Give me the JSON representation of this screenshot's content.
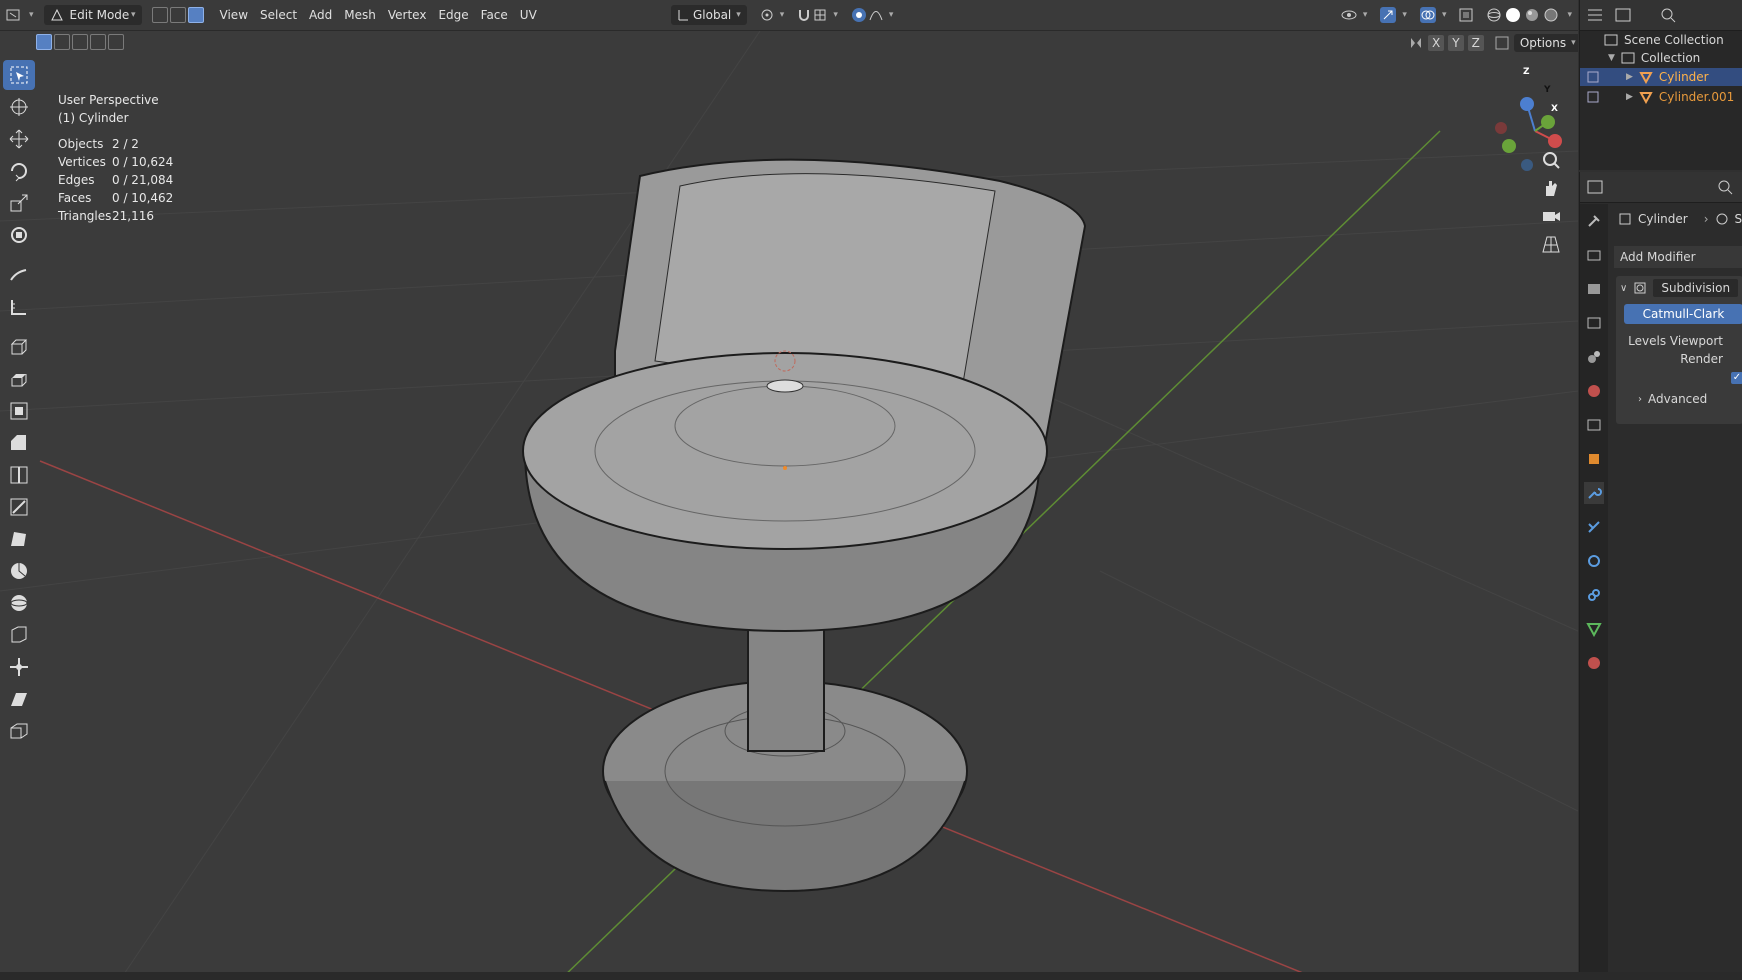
{
  "header": {
    "mode_label": "Edit Mode",
    "menus": [
      "View",
      "Select",
      "Add",
      "Mesh",
      "Vertex",
      "Edge",
      "Face",
      "UV"
    ],
    "orientation_label": "Global",
    "options_label": "Options",
    "axes": [
      "X",
      "Y",
      "Z"
    ]
  },
  "viewport": {
    "view_name": "User Perspective",
    "object_name": "(1) Cylinder",
    "stats": [
      {
        "label": "Objects",
        "value": "2 / 2"
      },
      {
        "label": "Vertices",
        "value": "0 / 10,624"
      },
      {
        "label": "Edges",
        "value": "0 / 21,084"
      },
      {
        "label": "Faces",
        "value": "0 / 10,462"
      },
      {
        "label": "Triangles",
        "value": "21,116"
      }
    ],
    "gizmo": {
      "x": "X",
      "y": "Y",
      "z": "Z"
    },
    "colors": {
      "x_axis": "#b34a4a",
      "y_axis": "#6aa33a",
      "accent": "#4772b3"
    }
  },
  "outliner": {
    "scene_collection": "Scene Collection",
    "collection": "Collection",
    "items": [
      {
        "name": "Cylinder"
      },
      {
        "name": "Cylinder.001"
      }
    ]
  },
  "properties": {
    "breadcrumb_object": "Cylinder",
    "breadcrumb_next": "S",
    "add_modifier": "Add Modifier",
    "modifier_name": "Subdivision",
    "mode_button": "Catmull-Clark",
    "levels_viewport_label": "Levels Viewport",
    "render_label": "Render",
    "advanced_label": "Advanced"
  }
}
